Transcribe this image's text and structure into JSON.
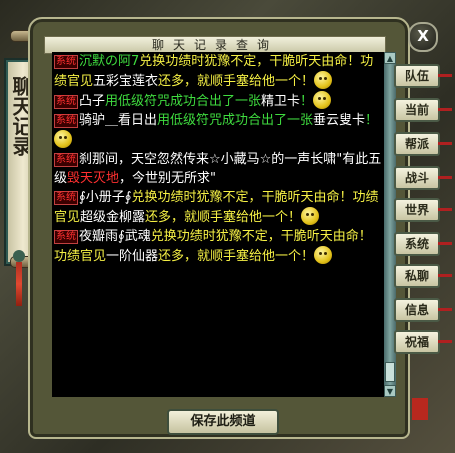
{
  "banner": {
    "title": "聊天记录"
  },
  "window": {
    "title": "聊天记录查询",
    "close_label": "X"
  },
  "tag_label": "系统",
  "messages": [
    {
      "parts": [
        {
          "t": "沉默の阿7",
          "c": "g"
        },
        {
          "t": "兑换功绩时犹豫不定，干脆听天由命！功绩官见",
          "c": "y"
        },
        {
          "t": "五彩宝莲衣",
          "c": "w"
        },
        {
          "t": "还多，就顺手塞给他一个！",
          "c": "y"
        }
      ],
      "emoji": true
    },
    {
      "parts": [
        {
          "t": "凸子",
          "c": "w"
        },
        {
          "t": "用低级符咒成功合出了一张",
          "c": "g"
        },
        {
          "t": "精卫卡",
          "c": "w"
        },
        {
          "t": "！",
          "c": "g"
        }
      ],
      "emoji": true
    },
    {
      "parts": [
        {
          "t": "骑驴＿看日出",
          "c": "w"
        },
        {
          "t": "用低级符咒成功合出了一张",
          "c": "g"
        },
        {
          "t": "垂云叟卡",
          "c": "w"
        },
        {
          "t": "！",
          "c": "g"
        }
      ],
      "emoji": true
    },
    {
      "parts": [
        {
          "t": "刹那间，天空忽然传来☆小藏马☆的一声长啸\"有此五级",
          "c": "w"
        },
        {
          "t": "毁天灭地",
          "c": "r"
        },
        {
          "t": "，今世别无所求\"",
          "c": "w"
        }
      ],
      "emoji": false
    },
    {
      "parts": [
        {
          "t": "∮小册子∮",
          "c": "w"
        },
        {
          "t": "兑换功绩时犹豫不定，干脆听天由命！功绩官见",
          "c": "y"
        },
        {
          "t": "超级金柳露",
          "c": "w"
        },
        {
          "t": "还多，就顺手塞给他一个！",
          "c": "y"
        }
      ],
      "emoji": true
    },
    {
      "parts": [
        {
          "t": "夜瓣雨∮武魂",
          "c": "w"
        },
        {
          "t": "兑换功绩时犹豫不定，干脆听天由命！功绩官见",
          "c": "y"
        },
        {
          "t": "一阶仙器",
          "c": "w"
        },
        {
          "t": "还多，就顺手塞给他一个！",
          "c": "y"
        }
      ],
      "emoji": true
    }
  ],
  "tabs": [
    "队伍",
    "当前",
    "帮派",
    "战斗",
    "世界",
    "系统",
    "私聊",
    "信息",
    "祝福"
  ],
  "save_label": "保存此频道",
  "seal": {
    "label": "印"
  }
}
